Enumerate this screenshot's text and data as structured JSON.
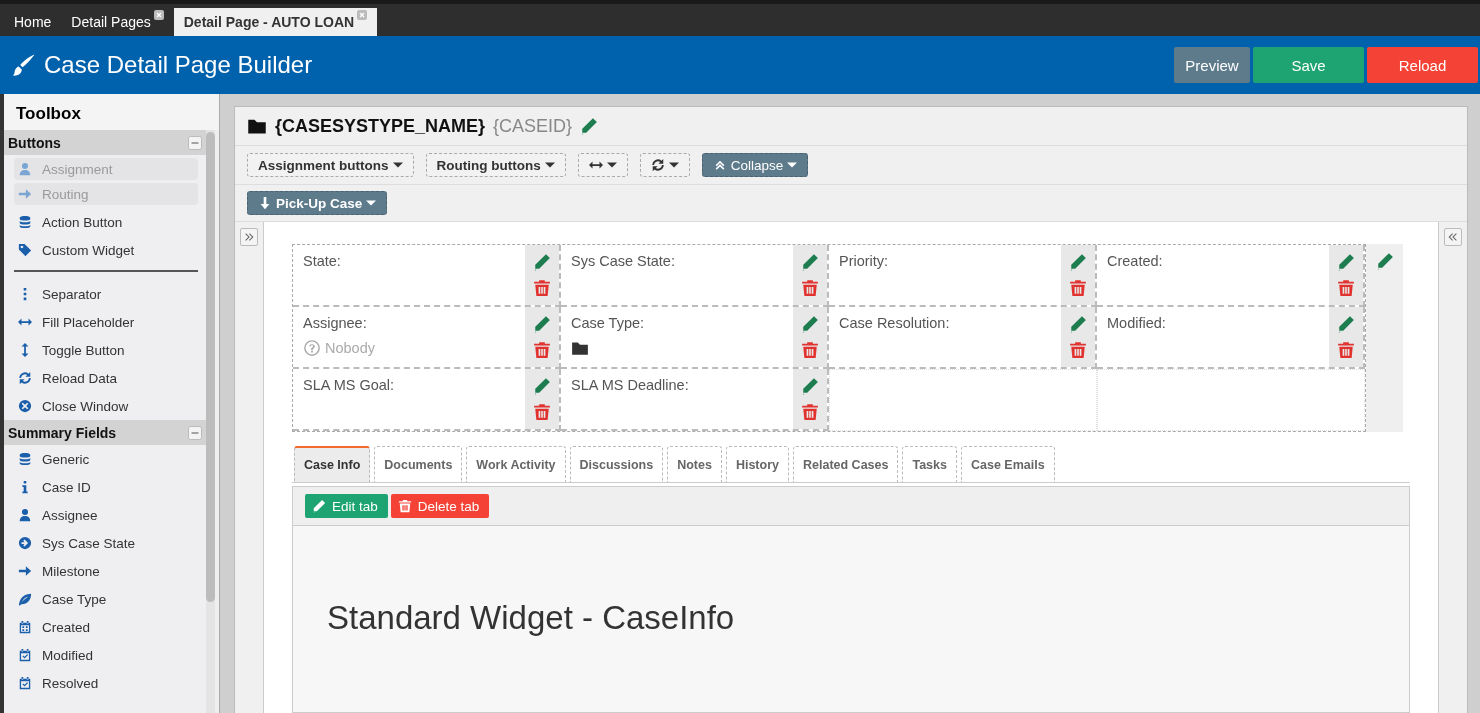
{
  "top_tabs": [
    {
      "label": "Home",
      "selected": false,
      "closable": false
    },
    {
      "label": "Detail Pages",
      "selected": false,
      "closable": true
    },
    {
      "label": "Detail Page - AUTO LOAN",
      "selected": true,
      "closable": true
    }
  ],
  "header": {
    "title": "Case Detail Page Builder",
    "buttons": [
      {
        "label": "Preview",
        "kind": "preview"
      },
      {
        "label": "Save",
        "kind": "save"
      },
      {
        "label": "Reload",
        "kind": "reload"
      }
    ]
  },
  "toolbox": {
    "title": "Toolbox",
    "sections": [
      {
        "title": "Buttons",
        "groups": [
          [
            {
              "label": "Assignment",
              "disabled": true
            },
            {
              "label": "Routing",
              "disabled": true
            },
            {
              "label": "Action Button",
              "disabled": false
            },
            {
              "label": "Custom Widget",
              "disabled": false
            }
          ],
          [
            {
              "label": "Separator",
              "disabled": false
            },
            {
              "label": "Fill Placeholder",
              "disabled": false
            },
            {
              "label": "Toggle Button",
              "disabled": false
            },
            {
              "label": "Reload Data",
              "disabled": false
            },
            {
              "label": "Close Window",
              "disabled": false
            }
          ]
        ]
      },
      {
        "title": "Summary Fields",
        "groups": [
          [
            {
              "label": "Generic",
              "disabled": false
            },
            {
              "label": "Case ID",
              "disabled": false
            },
            {
              "label": "Assignee",
              "disabled": false
            },
            {
              "label": "Sys Case State",
              "disabled": false
            },
            {
              "label": "Milestone",
              "disabled": false
            },
            {
              "label": "Case Type",
              "disabled": false
            },
            {
              "label": "Created",
              "disabled": false
            },
            {
              "label": "Modified",
              "disabled": false
            },
            {
              "label": "Resolved",
              "disabled": false
            }
          ]
        ]
      }
    ]
  },
  "page": {
    "case_type": "{CASESYSTYPE_NAME}",
    "case_id": "{CASEID}",
    "toolbar": [
      {
        "label": "Assignment buttons",
        "kind": "dashed"
      },
      {
        "label": "Routing buttons",
        "kind": "dashed"
      },
      {
        "kind": "dashed"
      },
      {
        "kind": "dashed"
      },
      {
        "label": "Collapse",
        "kind": "filled"
      }
    ],
    "action": {
      "label": "Pick-Up Case"
    },
    "fields": [
      [
        {
          "label": "State:",
          "kind": "text"
        },
        {
          "label": "Sys Case State:",
          "kind": "text"
        },
        {
          "label": "Priority:",
          "kind": "text"
        },
        {
          "label": "Created:",
          "kind": "text"
        }
      ],
      [
        {
          "label": "Assignee:",
          "kind": "text",
          "value": "Nobody"
        },
        {
          "label": "Case Type:",
          "kind": "folder"
        },
        {
          "label": "Case Resolution:",
          "kind": "text"
        },
        {
          "label": "Modified:",
          "kind": "text"
        }
      ],
      [
        {
          "label": "SLA MS Goal:",
          "kind": "text"
        },
        {
          "label": "SLA MS Deadline:",
          "kind": "text"
        },
        {
          "kind": "empty"
        },
        {
          "kind": "empty"
        }
      ]
    ],
    "tabs": [
      {
        "label": "Case Info",
        "selected": true
      },
      {
        "label": "Documents",
        "selected": false
      },
      {
        "label": "Work Activity",
        "selected": false
      },
      {
        "label": "Discussions",
        "selected": false
      },
      {
        "label": "Notes",
        "selected": false
      },
      {
        "label": "History",
        "selected": false
      },
      {
        "label": "Related Cases",
        "selected": false
      },
      {
        "label": "Tasks",
        "selected": false
      },
      {
        "label": "Case Emails",
        "selected": false
      }
    ],
    "tab_buttons": [
      {
        "label": "Edit tab",
        "kind": "edit"
      },
      {
        "label": "Delete tab",
        "kind": "delete"
      }
    ],
    "widget_title": "Standard Widget - CaseInfo"
  }
}
